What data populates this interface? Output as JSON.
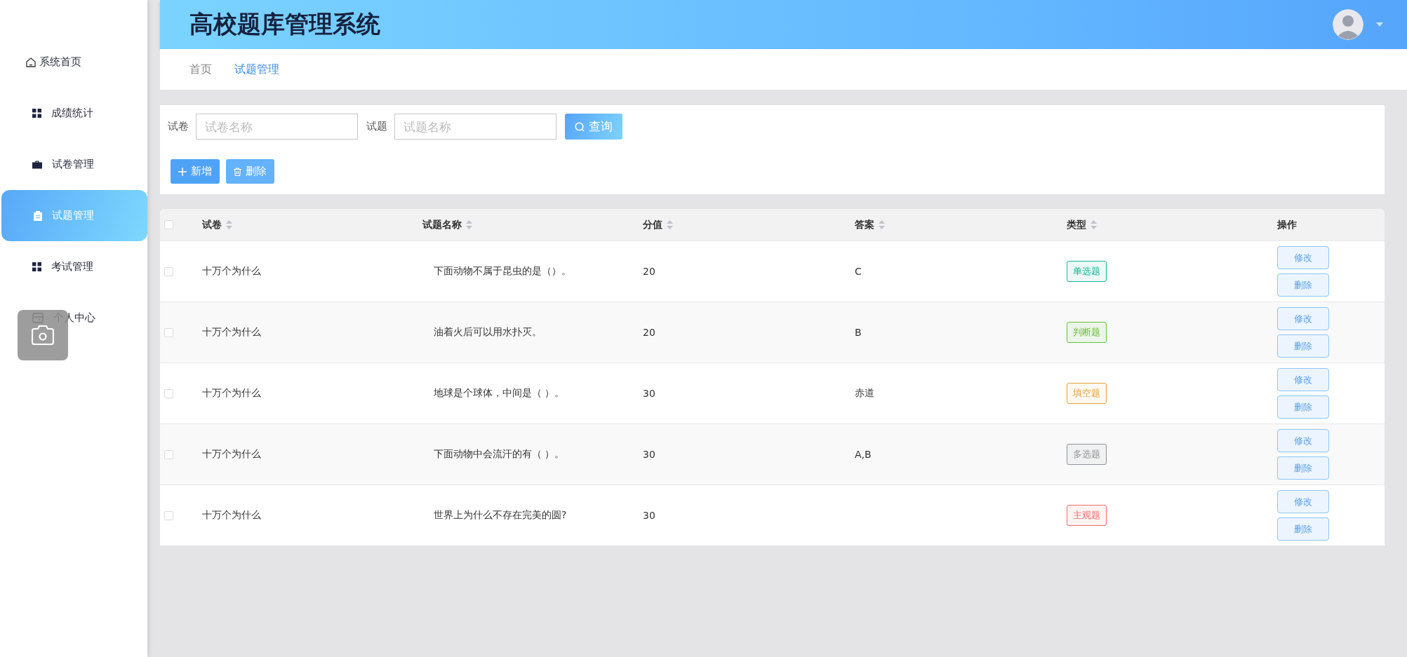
{
  "sidebar": {
    "items": [
      {
        "label": "系统首页",
        "kind": "home",
        "selected": false
      },
      {
        "label": "成绩统计",
        "kind": "grid",
        "selected": false
      },
      {
        "label": "试卷管理",
        "kind": "briefcase",
        "selected": false
      },
      {
        "label": "试题管理",
        "kind": "clipboard",
        "selected": true
      },
      {
        "label": "考试管理",
        "kind": "grid",
        "selected": false
      },
      {
        "label": "个人中心",
        "kind": "card",
        "selected": false
      }
    ]
  },
  "header": {
    "title": "高校题库管理系统"
  },
  "breadcrumb": [
    {
      "label": "首页",
      "selected": false
    },
    {
      "label": "试题管理",
      "selected": true
    }
  ],
  "search": {
    "fields": [
      {
        "label": "试卷",
        "placeholder": "试卷名称"
      },
      {
        "label": "试题",
        "placeholder": "试题名称"
      }
    ],
    "query_button": "查询",
    "add_button": "新增",
    "delete_button": "删除"
  },
  "table": {
    "all_checked": false,
    "columns": [
      {
        "label": "试卷",
        "sortable": true
      },
      {
        "label": "试题名称",
        "sortable": true
      },
      {
        "label": "分值",
        "sortable": true
      },
      {
        "label": "答案",
        "sortable": true
      },
      {
        "label": "类型",
        "sortable": true
      },
      {
        "label": "操作",
        "sortable": false
      }
    ],
    "rows": [
      {
        "checked": false,
        "paper": "十万个为什么",
        "question": "下面动物不属于昆虫的是（）。",
        "score": "20",
        "answer": "C",
        "type": {
          "label": "单选题",
          "color": "#13b89a"
        },
        "edit": "修改",
        "delete": "删除"
      },
      {
        "checked": false,
        "paper": "十万个为什么",
        "question": "油着火后可以用水扑灭。",
        "score": "20",
        "answer": "B",
        "type": {
          "label": "判断题",
          "color": "#67c23a"
        },
        "edit": "修改",
        "delete": "删除"
      },
      {
        "checked": false,
        "paper": "十万个为什么",
        "question": "地球是个球体，中间是（ ）。",
        "score": "30",
        "answer": "赤道",
        "type": {
          "label": "填空题",
          "color": "#e6a23c"
        },
        "edit": "修改",
        "delete": "删除"
      },
      {
        "checked": false,
        "paper": "十万个为什么",
        "question": "下面动物中会流汗的有（ ）。",
        "score": "30",
        "answer": "A,B",
        "type": {
          "label": "多选题",
          "color": "#909399"
        },
        "edit": "修改",
        "delete": "删除"
      },
      {
        "checked": false,
        "paper": "十万个为什么",
        "question": "世界上为什么不存在完美的圆?",
        "score": "30",
        "type": {
          "label": "主观题",
          "color": "#f56c6c"
        },
        "edit": "修改",
        "delete": "删除"
      }
    ]
  }
}
